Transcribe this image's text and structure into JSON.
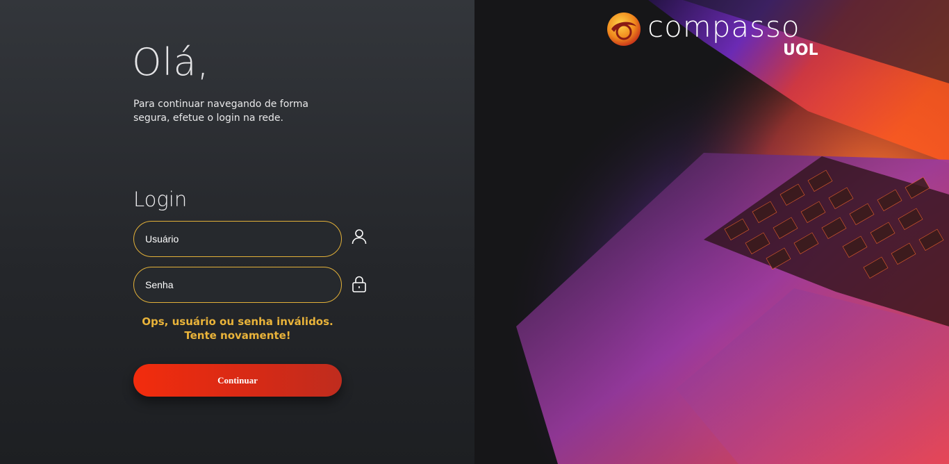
{
  "greeting": "Olá,",
  "subtitle": "Para continuar navegando de forma segura, efetue o login na rede.",
  "login": {
    "title": "Login",
    "username_placeholder": "Usuário",
    "password_placeholder": "Senha",
    "error_line1": "Ops, usuário ou senha inválidos.",
    "error_line2": "Tente novamente!",
    "submit_label": "Continuar"
  },
  "brand": {
    "name": "compasso",
    "sub": "UOL"
  },
  "icons": {
    "username": "user-icon",
    "password": "lock-icon"
  },
  "colors": {
    "accent": "#e3b139",
    "button": "#f22c0d",
    "error": "#e9b33a"
  }
}
